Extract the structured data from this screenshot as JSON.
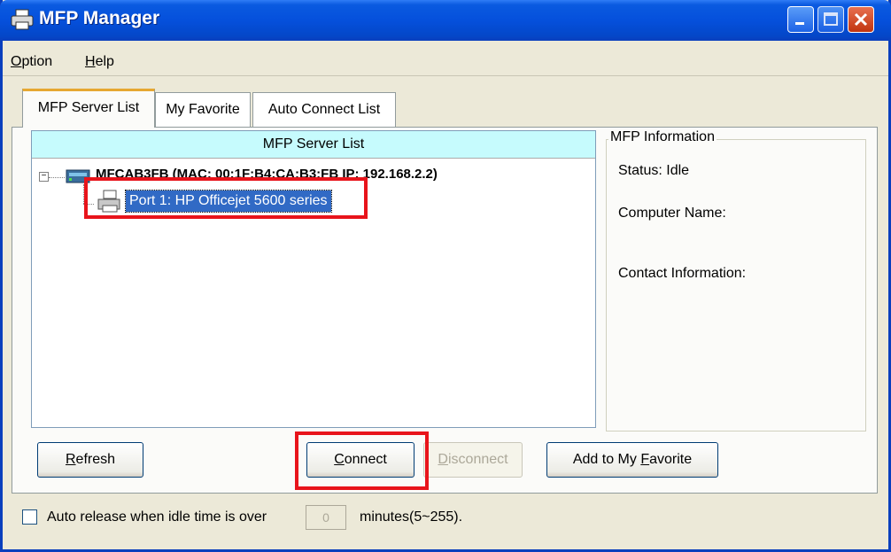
{
  "window": {
    "title": "MFP Manager"
  },
  "menu": {
    "option": "Option",
    "option_mnemonic": "O",
    "option_rest": "ption",
    "help": "Help",
    "help_mnemonic": "H",
    "help_rest": "elp"
  },
  "tabs": [
    {
      "label": "MFP Server List",
      "active": true
    },
    {
      "label": "My Favorite",
      "active": false
    },
    {
      "label": "Auto Connect List",
      "active": false
    }
  ],
  "server_list": {
    "header": "MFP Server List",
    "server": {
      "expander": "−",
      "label": "MFCAB3FB (MAC: 00:1F:B4:CA:B3:FB   IP: 192.168.2.2)"
    },
    "port": {
      "label": "Port 1: HP Officejet 5600 series",
      "selected": true
    }
  },
  "mfp_info": {
    "legend": "MFP Information",
    "status": "Status: Idle",
    "computer_name": "Computer Name:",
    "contact": "Contact Information:"
  },
  "buttons": {
    "refresh": {
      "mnemonic": "R",
      "rest": "efresh"
    },
    "connect": {
      "mnemonic": "C",
      "rest": "onnect"
    },
    "disconnect": {
      "mnemonic": "D",
      "rest": "isconnect"
    },
    "favorite": {
      "prefix": "Add to My ",
      "mnemonic": "F",
      "rest": "avorite"
    }
  },
  "auto_release": {
    "label": "Auto release when idle time is over",
    "value": "0",
    "suffix": "minutes(5~255).",
    "checked": false
  },
  "colors": {
    "titlebar": "#0550dc",
    "selection": "#316ac5",
    "header_bg": "#c6fbfd",
    "highlight": "#e8141b"
  }
}
